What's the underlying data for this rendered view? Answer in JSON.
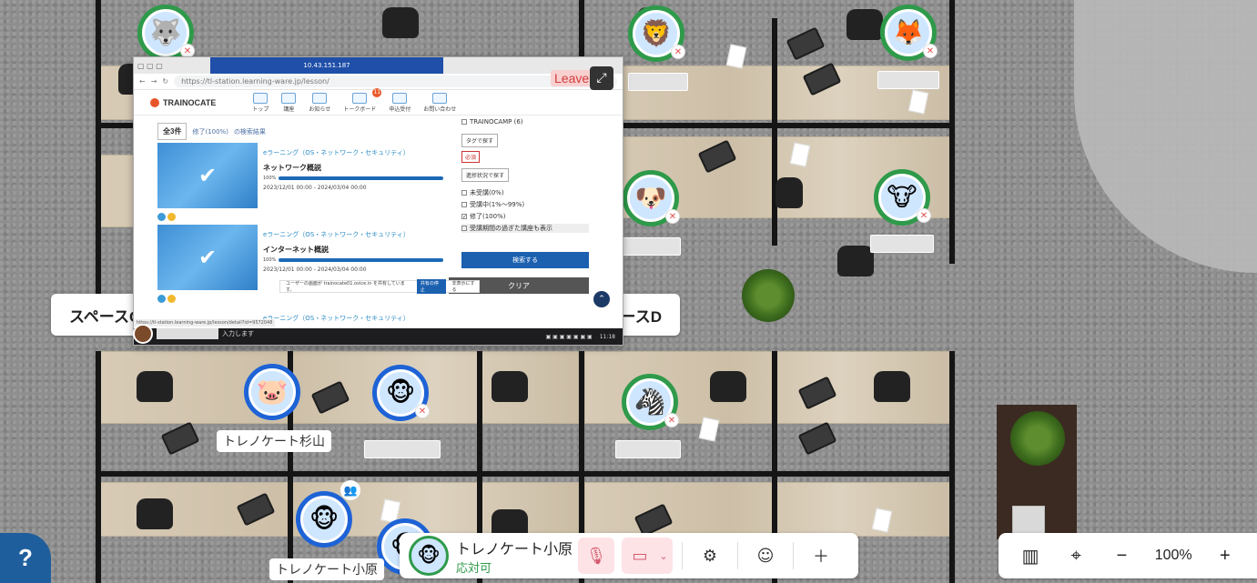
{
  "room_labels": {
    "left": "スペースC",
    "right": "スペースD"
  },
  "avatars": [
    {
      "name_tag": "トレノケート杉山"
    },
    {
      "name_tag": "トレノケート小原"
    }
  ],
  "shared_screen": {
    "remote_title": "10.43.151.187",
    "url": "https://tl-station.learning-ware.jp/lesson/",
    "logo": "TRAINOCATE",
    "nav": [
      {
        "label": "トップ"
      },
      {
        "label": "講座"
      },
      {
        "label": "お知らせ"
      },
      {
        "label": "トークボード",
        "badge": "11"
      },
      {
        "label": "申込受付"
      },
      {
        "label": "お問い合わせ"
      }
    ],
    "result_count": "全3件",
    "result_filter": "修了(100%)",
    "result_suffix": "の検索結果",
    "courses": [
      {
        "category": "eラーニング（OS・ネットワーク・セキュリティ）",
        "title": "ネットワーク概説",
        "progress": "100%",
        "date": "2023/12/01 00:00 - 2024/03/04 00:00"
      },
      {
        "category": "eラーニング（OS・ネットワーク・セキュリティ）",
        "title": "インターネット概説",
        "progress": "100%",
        "date": "2023/12/01 00:00 - 2024/03/04 00:00"
      },
      {
        "category": "eラーニング（OS・ネットワーク・セキュリティ）"
      }
    ],
    "filter": {
      "camp": "TRAINOCAMP (6)",
      "tag_heading": "タグで探す",
      "tag": "必須",
      "progress_heading": "進捗状況で探す",
      "options": [
        "未受講(0%)",
        "受講中(1%〜99%)",
        "修了(100%)",
        "受講期間の過ぎた講座も表示"
      ],
      "search_button": "検索する",
      "clear_button": "クリア"
    },
    "notification": "ユーザーの画面が trainocate01.ovice.in を共有しています。",
    "notification_stop": "共有の停止",
    "notification_hide": "非表示にする",
    "status_url": "https://tl-station.learning-ware.jp/lesson/detail?id=9572048",
    "presenter_suffix": "入力します",
    "taskbar_time": "11:18",
    "leave_label": "Leave"
  },
  "toolbar": {
    "user_name": "トレノケート小原",
    "user_status": "応対可"
  },
  "map_tools": {
    "zoom": "100%"
  },
  "colors": {
    "available_green": "#2e9a4a",
    "mute_red": "#d45a6c",
    "help_blue": "#1f5e9c"
  }
}
